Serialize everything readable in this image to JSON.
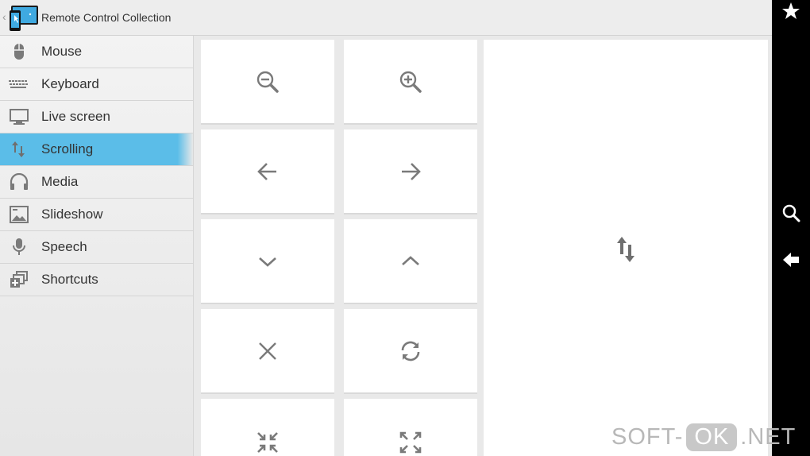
{
  "app": {
    "title": "Remote Control Collection"
  },
  "sidebar": {
    "items": [
      {
        "label": "Mouse",
        "icon": "mouse-icon",
        "active": false
      },
      {
        "label": "Keyboard",
        "icon": "keyboard-icon",
        "active": false
      },
      {
        "label": "Live screen",
        "icon": "monitor-icon",
        "active": false
      },
      {
        "label": "Scrolling",
        "icon": "scroll-arrows-icon",
        "active": true
      },
      {
        "label": "Media",
        "icon": "headphones-icon",
        "active": false
      },
      {
        "label": "Slideshow",
        "icon": "image-icon",
        "active": false
      },
      {
        "label": "Speech",
        "icon": "microphone-icon",
        "active": false
      },
      {
        "label": "Shortcuts",
        "icon": "shortcuts-icon",
        "active": false
      }
    ]
  },
  "tiles": [
    {
      "icon": "zoom-out-icon"
    },
    {
      "icon": "zoom-in-icon"
    },
    {
      "icon": "arrow-left-icon"
    },
    {
      "icon": "arrow-right-icon"
    },
    {
      "icon": "chevron-down-icon"
    },
    {
      "icon": "chevron-up-icon"
    },
    {
      "icon": "close-icon"
    },
    {
      "icon": "refresh-icon"
    },
    {
      "icon": "collapse-icon"
    },
    {
      "icon": "expand-icon"
    }
  ],
  "scroll_pad": {
    "icon": "scroll-arrows-icon"
  },
  "system_bar": {
    "buttons": [
      "star-icon",
      "search-icon",
      "back-arrow-icon"
    ]
  },
  "watermark": {
    "part1": "SOFT-",
    "part2": "OK",
    "part3": ".NET"
  },
  "colors": {
    "accent": "#5bbde8",
    "icon_gray": "#7a7a7a",
    "system_bar": "#000000"
  }
}
